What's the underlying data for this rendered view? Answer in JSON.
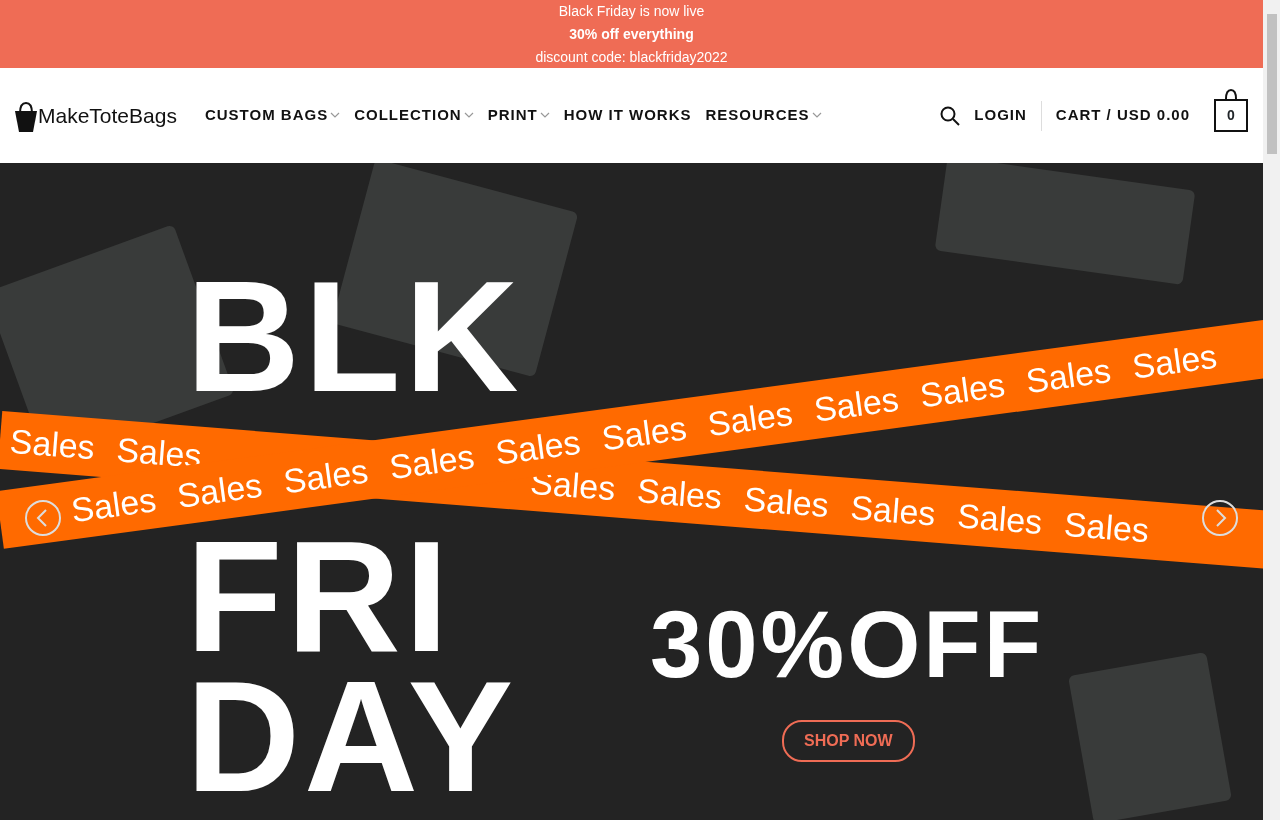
{
  "announcement": {
    "lines": [
      {
        "text": "Black Friday is now live",
        "bold": false
      },
      {
        "text": "30% off everything",
        "bold": true
      },
      {
        "text": "discount code: blackfriday2022",
        "bold": false
      }
    ]
  },
  "header": {
    "logo": "MakeToteBags",
    "nav": [
      {
        "label": "CUSTOM BAGS",
        "dropdown": true
      },
      {
        "label": "COLLECTION",
        "dropdown": true
      },
      {
        "label": "PRINT",
        "dropdown": true
      },
      {
        "label": "HOW IT WORKS",
        "dropdown": false
      },
      {
        "label": "RESOURCES",
        "dropdown": true
      }
    ],
    "login": "LOGIN",
    "cart": "CART / USD 0.00",
    "cart_count": "0"
  },
  "hero": {
    "headline": [
      "BLK",
      "FRI",
      "DAY"
    ],
    "offer": "30%OFF",
    "button": "SHOP NOW",
    "tapes": [
      {
        "segments": [
          [
            "Sales",
            "Sales"
          ],
          [
            "Sales",
            "Sales",
            "Sales",
            "Sales",
            "Sales",
            "Sales"
          ]
        ]
      },
      {
        "segments": [
          [
            "Sales",
            "Sales",
            "Sales",
            "Sales",
            "Sales",
            "Sales",
            "Sales",
            "Sales",
            "Sales",
            "Sales",
            "Sales"
          ]
        ]
      }
    ]
  }
}
